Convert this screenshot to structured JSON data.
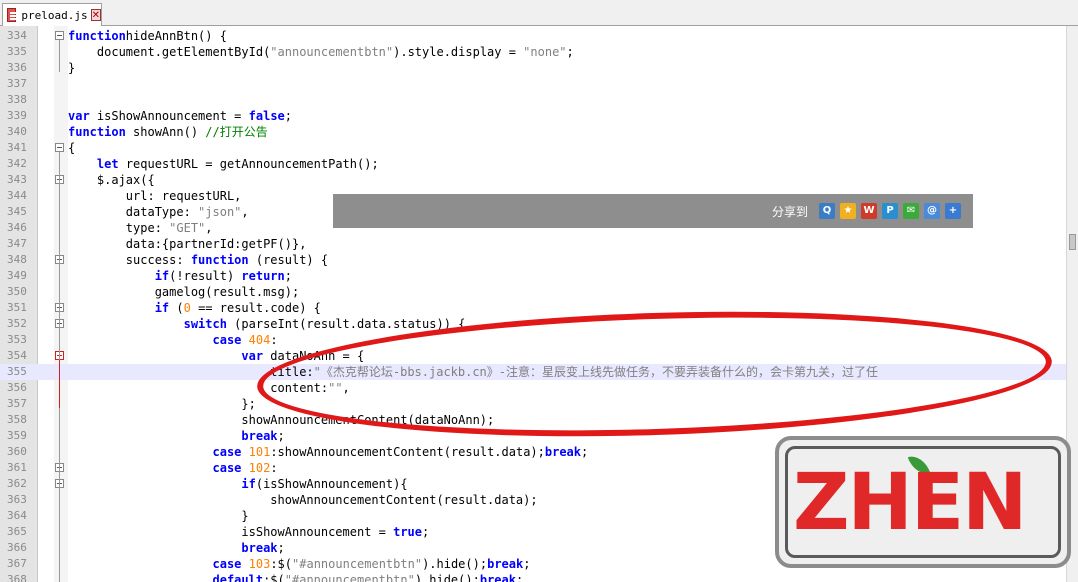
{
  "tab": {
    "label": "preload.js"
  },
  "share": {
    "label": "分享到"
  },
  "stamp": {
    "text": "ZHEN"
  },
  "lines": [
    {
      "n": "334",
      "fold": "minus",
      "tokens": [
        [
          "kw",
          "function"
        ],
        [
          "",
          "hideAnnBtn() {"
        ]
      ]
    },
    {
      "n": "335",
      "tokens": [
        [
          "",
          "    document.getElementById("
        ],
        [
          "str",
          "\"announcementbtn\""
        ],
        [
          "",
          ").style.display = "
        ],
        [
          "str",
          "\"none\""
        ],
        [
          "",
          ";"
        ]
      ]
    },
    {
      "n": "336",
      "fold": "end",
      "tokens": [
        [
          "",
          "}"
        ]
      ]
    },
    {
      "n": "337",
      "tokens": []
    },
    {
      "n": "338",
      "tokens": []
    },
    {
      "n": "339",
      "tokens": [
        [
          "kw",
          "var"
        ],
        [
          "",
          " isShowAnnouncement = "
        ],
        [
          "kw",
          "false"
        ],
        [
          "",
          ";"
        ]
      ]
    },
    {
      "n": "340",
      "tokens": [
        [
          "kw",
          "function"
        ],
        [
          "",
          " showAnn() "
        ],
        [
          "cm",
          "//打开公告"
        ]
      ]
    },
    {
      "n": "341",
      "fold": "minus",
      "tokens": [
        [
          "",
          "{"
        ]
      ]
    },
    {
      "n": "342",
      "tokens": [
        [
          "",
          "    "
        ],
        [
          "kw",
          "let"
        ],
        [
          "",
          " requestURL = getAnnouncementPath();"
        ]
      ]
    },
    {
      "n": "343",
      "fold": "minus",
      "tokens": [
        [
          "",
          "    $.ajax({"
        ]
      ]
    },
    {
      "n": "344",
      "tokens": [
        [
          "",
          "        url: requestURL,"
        ]
      ]
    },
    {
      "n": "345",
      "tokens": [
        [
          "",
          "        dataType: "
        ],
        [
          "str",
          "\"json\""
        ],
        [
          "",
          ","
        ]
      ]
    },
    {
      "n": "346",
      "tokens": [
        [
          "",
          "        type: "
        ],
        [
          "str",
          "\"GET\""
        ],
        [
          "",
          ","
        ]
      ]
    },
    {
      "n": "347",
      "tokens": [
        [
          "",
          "        data:{partnerId:getPF()},"
        ]
      ]
    },
    {
      "n": "348",
      "fold": "minus",
      "tokens": [
        [
          "",
          "        success: "
        ],
        [
          "kw",
          "function"
        ],
        [
          "",
          " (result) {"
        ]
      ]
    },
    {
      "n": "349",
      "tokens": [
        [
          "",
          "            "
        ],
        [
          "kw",
          "if"
        ],
        [
          "",
          "(!result) "
        ],
        [
          "kw",
          "return"
        ],
        [
          "",
          ";"
        ]
      ]
    },
    {
      "n": "350",
      "tokens": [
        [
          "",
          "            gamelog(result.msg);"
        ]
      ]
    },
    {
      "n": "351",
      "fold": "minus",
      "tokens": [
        [
          "",
          "            "
        ],
        [
          "kw",
          "if"
        ],
        [
          "",
          " ("
        ],
        [
          "num",
          "0"
        ],
        [
          "",
          " == result.code) {"
        ]
      ]
    },
    {
      "n": "352",
      "fold": "minus",
      "tokens": [
        [
          "",
          "                "
        ],
        [
          "kw",
          "switch"
        ],
        [
          "",
          " (parseInt(result.data.status)) {"
        ]
      ]
    },
    {
      "n": "353",
      "tokens": [
        [
          "",
          "                    "
        ],
        [
          "kw",
          "case"
        ],
        [
          "",
          " "
        ],
        [
          "num",
          "404"
        ],
        [
          "",
          ":"
        ]
      ]
    },
    {
      "n": "354",
      "fold": "red",
      "tokens": [
        [
          "",
          "                        "
        ],
        [
          "kw",
          "var"
        ],
        [
          "",
          " dataNoAnn = {"
        ]
      ]
    },
    {
      "n": "355",
      "hl": true,
      "tokens": [
        [
          "",
          "                            title:"
        ],
        [
          "str",
          "\"《杰克帮论坛-bbs.jackb.cn》-注意：星辰变上线先做任务，不要弄装备什么的，会卡第九关，过了任"
        ]
      ]
    },
    {
      "n": "356",
      "tokens": [
        [
          "",
          "                            content:"
        ],
        [
          "str",
          "\"\""
        ],
        [
          "",
          ","
        ]
      ]
    },
    {
      "n": "357",
      "fold": "endred",
      "tokens": [
        [
          "",
          "                        };"
        ]
      ]
    },
    {
      "n": "358",
      "tokens": [
        [
          "",
          "                        showAnnouncementContent(dataNoAnn);"
        ]
      ]
    },
    {
      "n": "359",
      "tokens": [
        [
          "",
          "                        "
        ],
        [
          "kw",
          "break"
        ],
        [
          "",
          ";"
        ]
      ]
    },
    {
      "n": "360",
      "tokens": [
        [
          "",
          "                    "
        ],
        [
          "kw",
          "case"
        ],
        [
          "",
          " "
        ],
        [
          "num",
          "101"
        ],
        [
          "",
          ":showAnnouncementContent(result.data);"
        ],
        [
          "kw",
          "break"
        ],
        [
          "",
          ";"
        ]
      ]
    },
    {
      "n": "361",
      "fold": "minus",
      "tokens": [
        [
          "",
          "                    "
        ],
        [
          "kw",
          "case"
        ],
        [
          "",
          " "
        ],
        [
          "num",
          "102"
        ],
        [
          "",
          ":"
        ]
      ]
    },
    {
      "n": "362",
      "fold": "minus",
      "tokens": [
        [
          "",
          "                        "
        ],
        [
          "kw",
          "if"
        ],
        [
          "",
          "(isShowAnnouncement){"
        ]
      ]
    },
    {
      "n": "363",
      "tokens": [
        [
          "",
          "                            showAnnouncementContent(result.data);"
        ]
      ]
    },
    {
      "n": "364",
      "fold": "end",
      "tokens": [
        [
          "",
          "                        }"
        ]
      ]
    },
    {
      "n": "365",
      "tokens": [
        [
          "",
          "                        isShowAnnouncement = "
        ],
        [
          "kw",
          "true"
        ],
        [
          "",
          ";"
        ]
      ]
    },
    {
      "n": "366",
      "tokens": [
        [
          "",
          "                        "
        ],
        [
          "kw",
          "break"
        ],
        [
          "",
          ";"
        ]
      ]
    },
    {
      "n": "367",
      "tokens": [
        [
          "",
          "                    "
        ],
        [
          "kw",
          "case"
        ],
        [
          "",
          " "
        ],
        [
          "num",
          "103"
        ],
        [
          "",
          ":$("
        ],
        [
          "str",
          "\"#announcementbtn\""
        ],
        [
          "",
          ").hide();"
        ],
        [
          "kw",
          "break"
        ],
        [
          "",
          ";"
        ]
      ]
    },
    {
      "n": "368",
      "tokens": [
        [
          "",
          "                    "
        ],
        [
          "kw",
          "default"
        ],
        [
          "",
          ":$("
        ],
        [
          "str",
          "\"#announcementbtn\""
        ],
        [
          "",
          ").hide();"
        ],
        [
          "kw",
          "break"
        ],
        [
          "",
          ";"
        ]
      ]
    }
  ]
}
